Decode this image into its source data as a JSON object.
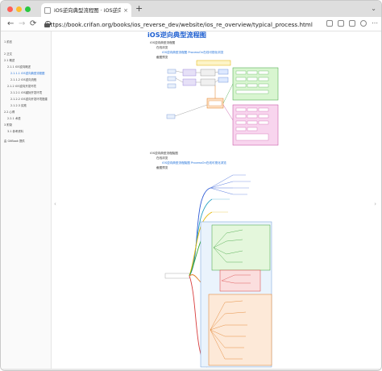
{
  "browser": {
    "tab_title": "iOS逆向典型流程图 · iOS逆向",
    "tab_close": "×",
    "new_tab": "+",
    "url": "https://book.crifan.org/books/ios_reverse_dev/website/ios_re_overview/typical_process.html",
    "nav": {
      "back": "←",
      "forward": "→",
      "reload": "⟳"
    }
  },
  "sidebar": {
    "items": [
      {
        "label": "1 前言",
        "level": 1,
        "active": false
      },
      {
        "label": "2 正文",
        "level": 1,
        "active": false
      },
      {
        "label": "2.1 概述",
        "level": 1,
        "active": false
      },
      {
        "label": "2.1.1 iOS逆向概述",
        "level": 2,
        "active": false
      },
      {
        "label": "2.1.1.1 iOS逆向典型流程图",
        "level": 3,
        "active": true
      },
      {
        "label": "2.1.1.2 iOS逆向流程",
        "level": 3,
        "active": false
      },
      {
        "label": "2.1.2 iOS逆向开发环境",
        "level": 2,
        "active": false
      },
      {
        "label": "2.1.2.1 iOS越狱开发环境",
        "level": 3,
        "active": false
      },
      {
        "label": "2.1.2.2 iOS逆向开发环境搭建",
        "level": 3,
        "active": false
      },
      {
        "label": "2.1.2.3 实践",
        "level": 3,
        "active": false
      },
      {
        "label": "2.2 心得",
        "level": 1,
        "active": false
      },
      {
        "label": "2.2.1 术语",
        "level": 2,
        "active": false
      },
      {
        "label": "3 附录",
        "level": 1,
        "active": false
      },
      {
        "label": "3.1 参考资料",
        "level": 2,
        "active": false
      },
      {
        "label": "由 GitBook 提供",
        "level": 1,
        "active": false
      }
    ]
  },
  "content": {
    "title": "iOS逆向典型流程图",
    "section1": {
      "heading": "iOS逆向典型流程图",
      "source_label": "在线浏览",
      "source_link": "iOS逆向典型流程图 ProcessOn在线可视化浏览",
      "preview_label": "截图预览"
    },
    "section2": {
      "heading": "iOS逆向典型流程脑图",
      "source_label": "在线浏览",
      "source_link": "iOS逆向典型流程脑图 ProcessOn在线可视化浏览",
      "preview_label": "截图预览"
    }
  },
  "colors": {
    "link": "#1e6fd9",
    "title": "#1e5fd0"
  }
}
